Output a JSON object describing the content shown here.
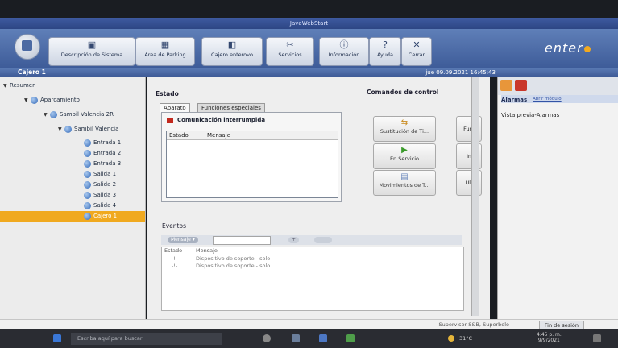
{
  "window": {
    "title": "JavaWebStart"
  },
  "toolbar": {
    "buttons": [
      {
        "label": "Descripción de Sistema",
        "icon": "monitor-icon"
      },
      {
        "label": "Area de Parking",
        "icon": "parking-map-icon"
      },
      {
        "label": "Cajero enterovo",
        "icon": "cashier-icon"
      },
      {
        "label": "Servicios",
        "icon": "tools-icon"
      },
      {
        "label": "Información",
        "icon": "info-icon"
      },
      {
        "label": "Ayuda",
        "icon": "help-icon"
      },
      {
        "label": "Cerrar",
        "icon": "close-icon"
      }
    ],
    "brand": "enter"
  },
  "section": {
    "title": "Cajero 1",
    "datetime": "jue 09.09.2021 16:45:43"
  },
  "tree": {
    "items": [
      {
        "label": "Resumen",
        "level": 0
      },
      {
        "label": "Aparcamiento",
        "level": 1
      },
      {
        "label": "Sambil Valencia 2R",
        "level": 2
      },
      {
        "label": "Sambil Valencia",
        "level": 3
      },
      {
        "label": "Entrada 1",
        "level": 4
      },
      {
        "label": "Entrada 2",
        "level": 4
      },
      {
        "label": "Entrada 3",
        "level": 4
      },
      {
        "label": "Salida 1",
        "level": 4
      },
      {
        "label": "Salida 2",
        "level": 4
      },
      {
        "label": "Salida 3",
        "level": 4
      },
      {
        "label": "Salida 4",
        "level": 4
      },
      {
        "label": "Cajero 1",
        "level": 4,
        "selected": true
      }
    ]
  },
  "main": {
    "estado_heading": "Estado",
    "tabs": [
      "Aparato",
      "Funciones especiales"
    ],
    "alert": "Comunicación interrumpida",
    "grid_headers": [
      "Estado",
      "Mensaje"
    ],
    "commands_heading": "Comandos de control",
    "commands": [
      {
        "label": "Sustitución de Ti...",
        "icon": "swap-icon"
      },
      {
        "label": "Fun.",
        "icon": ""
      },
      {
        "label": "En Servicio",
        "icon": "play-icon"
      },
      {
        "label": "In",
        "icon": ""
      },
      {
        "label": "Movimientos de T...",
        "icon": "movements-icon"
      },
      {
        "label": "Ult",
        "icon": ""
      }
    ],
    "eventos_heading": "Eventos",
    "filter": {
      "dropdown": "Mensaje",
      "add": "+"
    },
    "events_headers": [
      "Estado",
      "Mensaje"
    ],
    "events": [
      {
        "estado": "-!-",
        "mensaje": "Dispositivo de soporte - solo"
      },
      {
        "estado": "-!-",
        "mensaje": "Dispositivo de soporte - solo"
      }
    ]
  },
  "alarms": {
    "title": "Alarmas",
    "link": "Abrir módulo",
    "preview": "Vista previa-Alarmas"
  },
  "status": {
    "user": "Supervisor S&B, Superbolo",
    "logout": "Fin de sesión"
  },
  "taskbar": {
    "search": "Escriba aquí para buscar",
    "temp": "31°C",
    "time": "4:45 p. m.",
    "date": "9/9/2021"
  },
  "colors": {
    "toolbar": "#4a6aa8",
    "selected": "#f0a91f",
    "alert": "#c2291e"
  }
}
